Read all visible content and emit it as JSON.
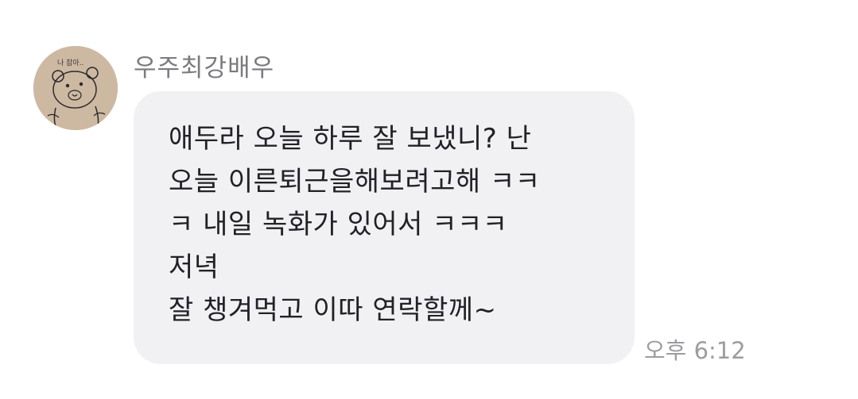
{
  "sender": {
    "name": "우주최강배우",
    "avatar_icon": "bear-drawing-avatar",
    "avatar_text": "나 잡아.."
  },
  "message": {
    "lines": [
      "애두라 오늘 하루 잘 보냈니? 난",
      "오늘 이른퇴근을해보려고해 ㅋㅋ",
      "ㅋ 내일 녹화가 있어서 ㅋㅋㅋ",
      "저녁",
      "잘 챙겨먹고 이따 연락할께~"
    ],
    "time": "오후 6:12"
  },
  "colors": {
    "bubble": "#f1f1f4",
    "text": "#222226",
    "muted": "#9c9ca2"
  }
}
